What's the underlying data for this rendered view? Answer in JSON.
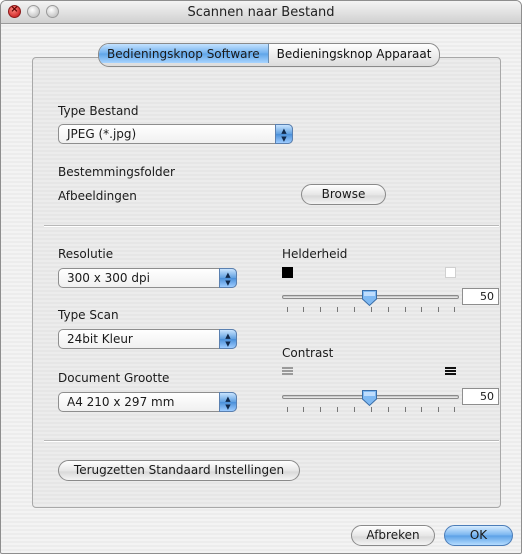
{
  "window": {
    "title": "Scannen naar Bestand"
  },
  "tabs": {
    "software": "Bedieningsknop Software",
    "device": "Bedieningsknop Apparaat"
  },
  "file_type": {
    "label": "Type Bestand",
    "value": "JPEG (*.jpg)"
  },
  "destination": {
    "label": "Bestemmingsfolder",
    "folder": "Afbeeldingen",
    "browse_label": "Browse"
  },
  "resolution": {
    "label": "Resolutie",
    "value": "300 x 300 dpi"
  },
  "scan_type": {
    "label": "Type Scan",
    "value": "24bit Kleur"
  },
  "document_size": {
    "label": "Document Grootte",
    "value": "A4 210 x 297 mm"
  },
  "brightness": {
    "label": "Helderheid",
    "value": "50"
  },
  "contrast": {
    "label": "Contrast",
    "value": "50"
  },
  "reset_label": "Terugzetten Standaard Instellingen",
  "footer": {
    "cancel_label": "Afbreken",
    "ok_label": "OK"
  }
}
